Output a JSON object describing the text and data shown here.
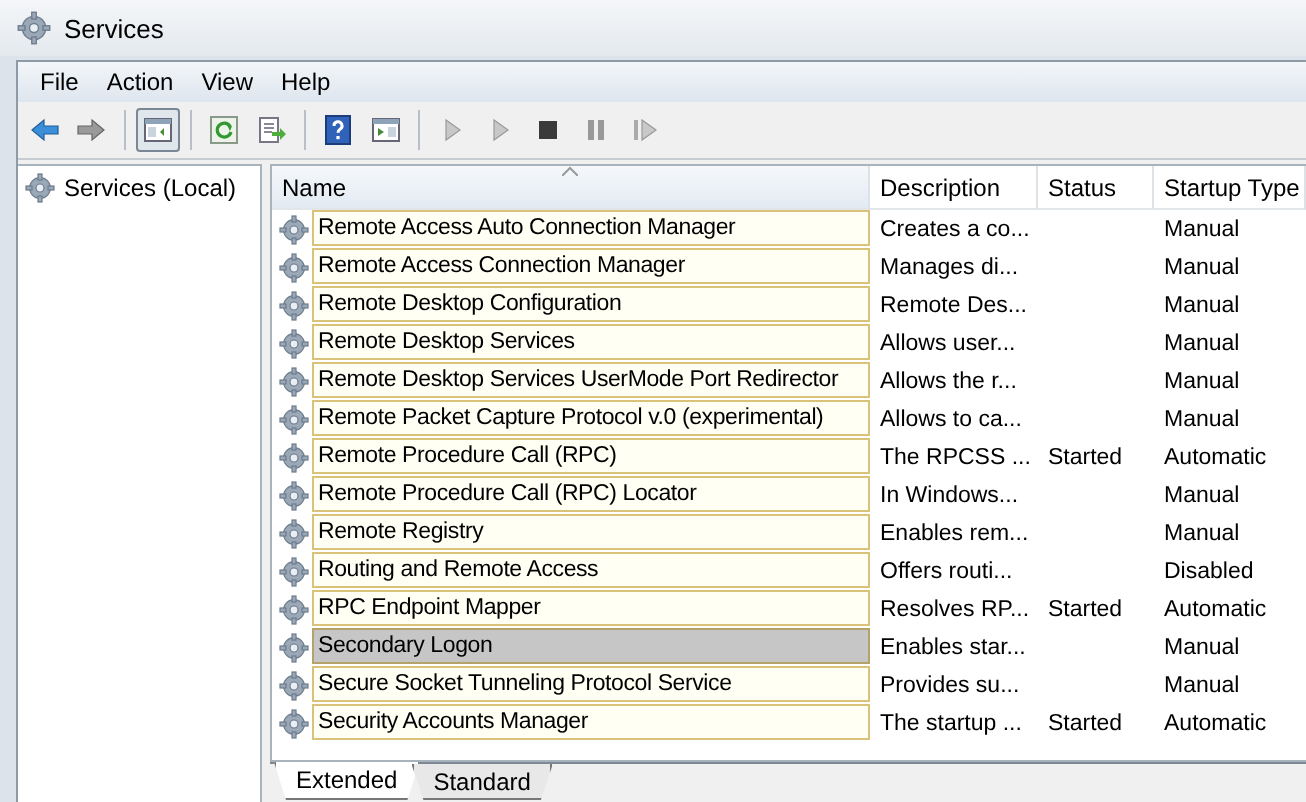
{
  "window": {
    "title": "Services"
  },
  "menu": [
    {
      "label": "File"
    },
    {
      "label": "Action"
    },
    {
      "label": "View"
    },
    {
      "label": "Help"
    }
  ],
  "toolbar": [
    {
      "kind": "back",
      "pressed": false
    },
    {
      "kind": "forward",
      "pressed": false
    },
    {
      "kind": "separator"
    },
    {
      "kind": "console-tree",
      "pressed": true
    },
    {
      "kind": "separator"
    },
    {
      "kind": "refresh",
      "pressed": false
    },
    {
      "kind": "export",
      "pressed": false
    },
    {
      "kind": "separator"
    },
    {
      "kind": "help",
      "pressed": false
    },
    {
      "kind": "properties",
      "pressed": false
    },
    {
      "kind": "separator"
    },
    {
      "kind": "start",
      "pressed": false
    },
    {
      "kind": "start",
      "pressed": false
    },
    {
      "kind": "stop",
      "pressed": false
    },
    {
      "kind": "pause",
      "pressed": false
    },
    {
      "kind": "resume",
      "pressed": false
    }
  ],
  "sidebar": {
    "items": [
      {
        "label": "Services (Local)",
        "selected": false
      }
    ]
  },
  "table": {
    "columns": [
      "Name",
      "Description",
      "Status",
      "Startup Type"
    ],
    "rows": [
      {
        "name": "Remote Access Auto Connection Manager",
        "description": "Creates a co...",
        "startup_type": "Manual",
        "selected": false
      },
      {
        "name": "Remote Access Connection Manager",
        "description": "Manages di...",
        "startup_type": "Manual",
        "selected": false
      },
      {
        "name": "Remote Desktop Configuration",
        "description": "Remote Des...",
        "startup_type": "Manual",
        "selected": false
      },
      {
        "name": "Remote Desktop Services",
        "description": "Allows user...",
        "startup_type": "Manual",
        "selected": false
      },
      {
        "name": "Remote Desktop Services UserMode Port Redirector",
        "description": "Allows the r...",
        "startup_type": "Manual",
        "selected": false
      },
      {
        "name": "Remote Packet Capture Protocol v.0 (experimental)",
        "description": "Allows to ca...",
        "startup_type": "Manual",
        "selected": false
      },
      {
        "name": "Remote Procedure Call (RPC)",
        "description": "The RPCSS ...",
        "status": "Started",
        "startup_type": "Automatic",
        "selected": false
      },
      {
        "name": "Remote Procedure Call (RPC) Locator",
        "description": "In Windows...",
        "startup_type": "Manual",
        "selected": false
      },
      {
        "name": "Remote Registry",
        "description": "Enables rem...",
        "startup_type": "Manual",
        "selected": false
      },
      {
        "name": "Routing and Remote Access",
        "description": "Offers routi...",
        "startup_type": "Disabled",
        "selected": false
      },
      {
        "name": "RPC Endpoint Mapper",
        "description": "Resolves RP...",
        "status": "Started",
        "startup_type": "Automatic",
        "selected": false
      },
      {
        "name": "Secondary Logon",
        "description": "Enables star...",
        "startup_type": "Manual",
        "selected": true
      },
      {
        "name": "Secure Socket Tunneling Protocol Service",
        "description": "Provides su...",
        "startup_type": "Manual",
        "selected": false
      },
      {
        "name": "Security Accounts Manager",
        "description": "The startup ...",
        "status": "Started",
        "startup_type": "Automatic",
        "selected": false
      }
    ]
  },
  "tabs": [
    {
      "label": "Extended",
      "selected": true
    },
    {
      "label": "Standard",
      "selected": false
    }
  ]
}
